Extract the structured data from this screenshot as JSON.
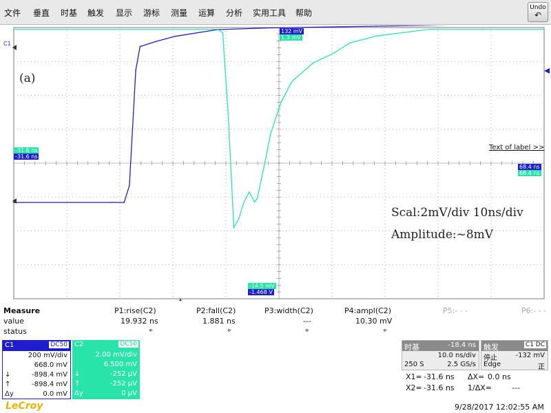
{
  "menu": [
    "文件",
    "垂直",
    "时基",
    "触发",
    "显示",
    "游标",
    "测量",
    "运算",
    "分析",
    "实用工具",
    "帮助"
  ],
  "undo_label": "Undo",
  "plot": {
    "c1_tag": "C1",
    "annotation_label": "(a)",
    "annotation_scale": "Scal:2mV/div 10ns/div",
    "annotation_amplitude": "Amplitude:~8mV",
    "text_of_label": "Text of label >>",
    "readouts": {
      "top_blue": "132 mV",
      "top_green": "1.3 mV",
      "left_green": "-31.6 ns",
      "left_blue": "-31.6 ns",
      "right_blue": "68.4 ns",
      "right_green": "68.4 ns",
      "bottom_green": "-14.5 mV",
      "bottom_blue": "-1.468 V"
    },
    "colors": {
      "c1": "#1e1ecc",
      "c2": "#28e4a8",
      "grid": "#7a7a7a"
    }
  },
  "chart_data": {
    "type": "line",
    "x_unit": "ns",
    "xlim": [
      -48.4,
      51.6
    ],
    "x_divisions": 10,
    "y_divisions": 8,
    "grid": true,
    "series": [
      {
        "name": "C1",
        "y_unit": "V",
        "y_scale_per_div": 0.2,
        "y_offset": 0.668,
        "x": [
          -48.4,
          -30,
          -27.6,
          -26.6,
          -25.4,
          -24.6,
          -21.6,
          -18,
          -10,
          0,
          10,
          20,
          30,
          40,
          51.6
        ],
        "y": [
          -0.9,
          -0.9,
          -0.9,
          -0.8,
          -0.12,
          0.02,
          0.05,
          0.08,
          0.12,
          0.13,
          0.135,
          0.14,
          0.145,
          0.15,
          0.15
        ]
      },
      {
        "name": "C2",
        "y_unit": "mV",
        "y_scale_per_div": 2.0,
        "y_offset": 6.5,
        "x": [
          -48.4,
          -10,
          -9,
          -8,
          -6.9,
          -6,
          -5,
          -4,
          -3,
          -2.5,
          -1,
          0,
          2,
          4,
          8,
          12,
          15,
          20,
          25,
          30,
          40,
          51.6
        ],
        "y": [
          1.4,
          1.4,
          1.2,
          -3.5,
          -10.3,
          -9.8,
          -8.8,
          -8.2,
          -8.8,
          -8.6,
          -6.4,
          -4.8,
          -2.9,
          -1.7,
          -0.6,
          0.0,
          0.6,
          1.0,
          1.2,
          1.4,
          1.4,
          1.4
        ]
      }
    ]
  },
  "measure": {
    "title": "Measure",
    "headers": [
      "P1:rise(C2)",
      "P2:fall(C2)",
      "P3:width(C2)",
      "P4:ampl(C2)",
      "P5:- - -",
      "P6:- - -"
    ],
    "row_labels": [
      "value",
      "status"
    ],
    "values": [
      "19.932 ns",
      "1.881 ns",
      "---",
      "10.30 mV",
      "",
      ""
    ]
  },
  "c1": {
    "name": "C1",
    "coupling": "DC50",
    "vdiv": "200 mV/div",
    "offset": "668.0 mV",
    "min_sym": "↓",
    "min": "-898.4 mV",
    "max_sym": "↑",
    "max": "-898.4 mV",
    "dy_sym": "Δy",
    "dy": "0.0 mV"
  },
  "c2": {
    "name": "C2",
    "coupling": "DC50",
    "vdiv": "2.00 mV/div",
    "offset": "6.500 mV",
    "min_sym": "↓",
    "min": "-252 μV",
    "max_sym": "↑",
    "max": "-252 μV",
    "dy_sym": "Δy",
    "dy": "0 μV"
  },
  "timebase": {
    "title": "时基",
    "delay": "-18.4 ns",
    "tdiv": "10.0 ns/div",
    "samples": "250 S",
    "rate": "2.5 GS/s"
  },
  "trigger": {
    "title": "触发",
    "badge": "C1 DC",
    "mode": "停止",
    "level": "-132 mV",
    "type": "Edge",
    "slope": "正"
  },
  "cursors": {
    "x1_label": "X1=",
    "x1": "-31.6 ns",
    "dx_label": "ΔX=",
    "dx": "0.0 ns",
    "x2_label": "X2=",
    "x2": "-31.6 ns",
    "inv_dx_label": "1/ΔX=",
    "inv_dx": "---"
  },
  "footer": {
    "logo": "LeCroy",
    "timestamp": "9/28/2017 12:02:55 AM"
  }
}
